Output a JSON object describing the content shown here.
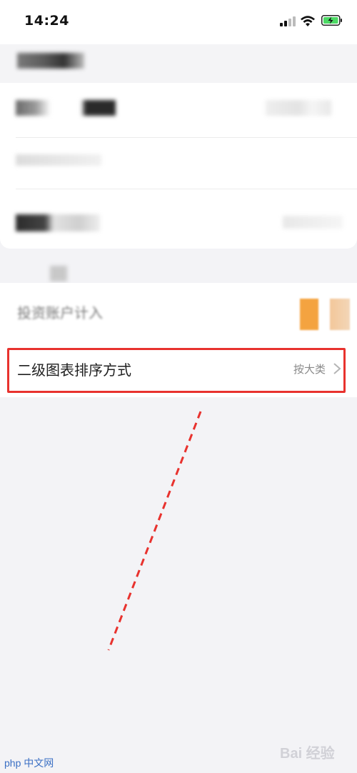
{
  "status_bar": {
    "time": "14:24"
  },
  "settings": {
    "invest_account_label": "投资账户计入",
    "sort_row": {
      "label": "二级图表排序方式",
      "value": "按大类"
    }
  },
  "watermarks": {
    "php": "php 中文网",
    "baidu": "Bai 经验"
  },
  "colors": {
    "highlight": "#e8322e",
    "toggle": "#f4a340",
    "background": "#f3f3f6"
  },
  "icons": {
    "chevron": "chevron-right-icon",
    "signal": "cellular-signal-icon",
    "wifi": "wifi-icon",
    "battery": "battery-charging-icon"
  }
}
